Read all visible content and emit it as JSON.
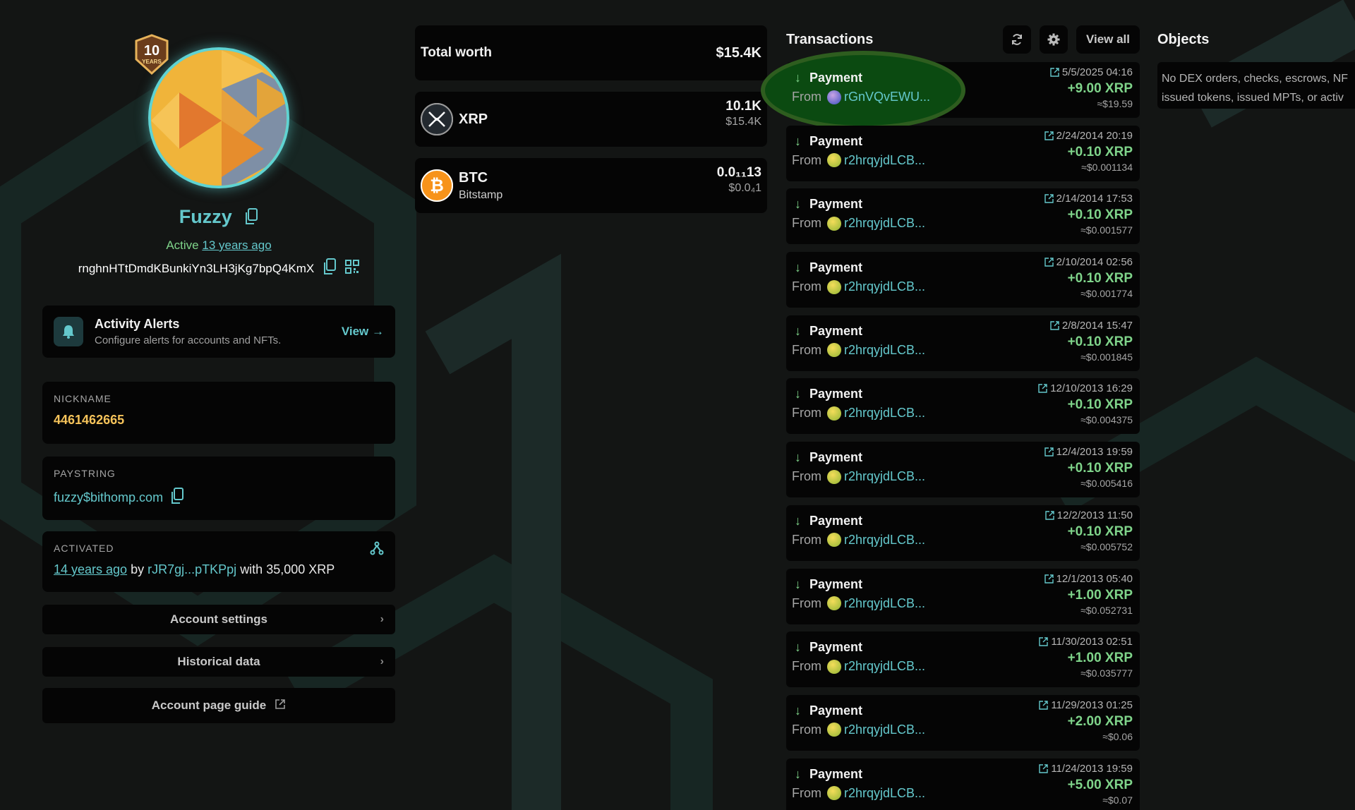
{
  "profile": {
    "name": "Fuzzy",
    "active_prefix": "Active",
    "active_ago": "13 years ago",
    "address": "rnghnHTtDmdKBunkiYn3LH3jKg7bpQ4KmX",
    "badge_text": "10",
    "badge_sub": "YEARS"
  },
  "alerts": {
    "title": "Activity Alerts",
    "subtitle": "Configure alerts for accounts and NFTs.",
    "view": "View →"
  },
  "nickname": {
    "label": "NICKNAME",
    "value": "4461462665"
  },
  "paystring": {
    "label": "PAYSTRING",
    "value": "fuzzy$bithomp.com"
  },
  "activated": {
    "label": "ACTIVATED",
    "ago": "14 years ago",
    "by": "by",
    "account": "rJR7gj...pTKPpj",
    "with": "with 35,000 XRP"
  },
  "buttons": {
    "account_settings": "Account settings",
    "historical_data": "Historical data",
    "guide": "Account page guide"
  },
  "worth": {
    "label": "Total worth",
    "value": "$15.4K"
  },
  "assets": [
    {
      "name": "XRP",
      "issuer": "",
      "amount": "10.1K",
      "usd": "$15.4K"
    },
    {
      "name": "BTC",
      "issuer": "Bitstamp",
      "amount": "0.0₁₁13",
      "usd": "$0.0₄1"
    }
  ],
  "transactions": {
    "title": "Transactions",
    "view_all": "View all",
    "from_label": "From",
    "items": [
      {
        "type": "Payment",
        "account": "rGnVQvEWU...",
        "date": "5/5/2025 04:16",
        "amount": "+9.00 XRP",
        "usd": "≈$19.59"
      },
      {
        "type": "Payment",
        "account": "r2hrqyjdLCB...",
        "date": "2/24/2014 20:19",
        "amount": "+0.10 XRP",
        "usd": "≈$0.001134"
      },
      {
        "type": "Payment",
        "account": "r2hrqyjdLCB...",
        "date": "2/14/2014 17:53",
        "amount": "+0.10 XRP",
        "usd": "≈$0.001577"
      },
      {
        "type": "Payment",
        "account": "r2hrqyjdLCB...",
        "date": "2/10/2014 02:56",
        "amount": "+0.10 XRP",
        "usd": "≈$0.001774"
      },
      {
        "type": "Payment",
        "account": "r2hrqyjdLCB...",
        "date": "2/8/2014 15:47",
        "amount": "+0.10 XRP",
        "usd": "≈$0.001845"
      },
      {
        "type": "Payment",
        "account": "r2hrqyjdLCB...",
        "date": "12/10/2013 16:29",
        "amount": "+0.10 XRP",
        "usd": "≈$0.004375"
      },
      {
        "type": "Payment",
        "account": "r2hrqyjdLCB...",
        "date": "12/4/2013 19:59",
        "amount": "+0.10 XRP",
        "usd": "≈$0.005416"
      },
      {
        "type": "Payment",
        "account": "r2hrqyjdLCB...",
        "date": "12/2/2013 11:50",
        "amount": "+0.10 XRP",
        "usd": "≈$0.005752"
      },
      {
        "type": "Payment",
        "account": "r2hrqyjdLCB...",
        "date": "12/1/2013 05:40",
        "amount": "+1.00 XRP",
        "usd": "≈$0.052731"
      },
      {
        "type": "Payment",
        "account": "r2hrqyjdLCB...",
        "date": "11/30/2013 02:51",
        "amount": "+1.00 XRP",
        "usd": "≈$0.035777"
      },
      {
        "type": "Payment",
        "account": "r2hrqyjdLCB...",
        "date": "11/29/2013 01:25",
        "amount": "+2.00 XRP",
        "usd": "≈$0.06"
      },
      {
        "type": "Payment",
        "account": "r2hrqyjdLCB...",
        "date": "11/24/2013 19:59",
        "amount": "+5.00 XRP",
        "usd": "≈$0.07"
      }
    ]
  },
  "objects": {
    "title": "Objects",
    "line1": "No DEX orders, checks, escrows, NF",
    "line2": "issued tokens, issued MPTs, or activ"
  },
  "colors": {
    "accent": "#64c8cc",
    "positive": "#7fd48a",
    "nickname": "#f5c35a",
    "highlight": "#0b4a11"
  }
}
